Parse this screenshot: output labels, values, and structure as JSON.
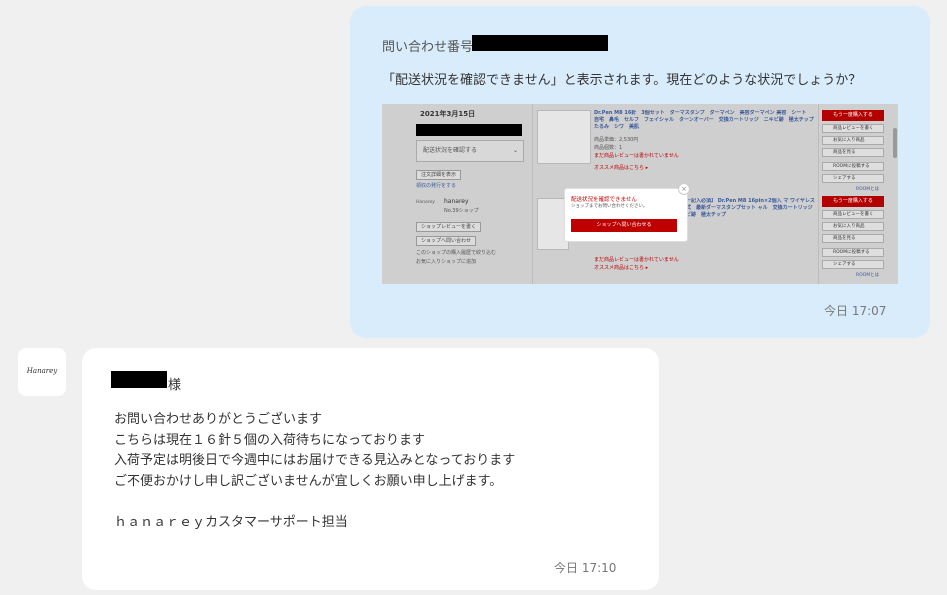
{
  "user_message": {
    "inquiry_label": "問い合わせ番号:",
    "text": "「配送状況を確認できません」と表示されます。現在どのような状況でしょうか？",
    "timestamp": "今日 17:07",
    "attached_screenshot": {
      "order_date": "2021年3月15日",
      "delivery_select": "配送状況を確認する",
      "order_detail_button": "注文詳細を表示",
      "receipt_link": "領収の発行をする",
      "shop_name": "hanarey",
      "shop_rating": "No.39ショップ",
      "shop_review_button": "ショップレビューを書く",
      "shop_contact_button": "ショップへ問い合わせ",
      "shop_note1": "このショップの購入履歴で絞り込む",
      "shop_note2": "お気に入りショップに追加",
      "product1_title": "Dr.Pen M8 16針　3個セット　ダーマスタンプ　ダーマペン　美容ダーマペン 美容　シート　自宅　鼻毛　セルフ　フェイシャル　ターンオーバー　交換カートリッジ　ニキビ跡　極太チップ　たるみ　シワ　美肌",
      "product1_price": "商品単価：2,530円",
      "product1_qty": "商品個数：1",
      "product1_review": "まだ商品レビューは書かれていません",
      "recommend": "オススメ商品はこちら ▸",
      "product2_title": "ビュー記入必須】 Dr.Pen M8 16pin×2個入 マ ワイヤレス　充電式　最新ダーマスタンプセット ャル　交換カートリッジ　ニキビ跡　極太チップ",
      "buy_again": "もう一度購入する",
      "write_review": "商品レビューを書く",
      "favorite": "お気に入り商品",
      "view_product": "商品を見る",
      "room_post": "ROOMに投稿する",
      "share": "シェアする",
      "room_link": "ROOMとは",
      "popup_title": "配送状況を確認できません",
      "popup_sub": "ショップまでお問い合わせください。",
      "popup_button": "ショップへ問い合わせる"
    }
  },
  "shop_message": {
    "shop_logo_text": "Hanarey",
    "honorific": "様",
    "lines": [
      "お問い合わせありがとうございます",
      "こちらは現在１６針５個の入荷待ちになっております",
      "入荷予定は明後日で今週中にはお届けできる見込みとなっております",
      "ご不便おかけし申し訳ございませんが宜しくお願い申し上げます。"
    ],
    "signature": "ｈａｎａｒｅｙカスタマーサポート担当",
    "timestamp": "今日 17:10"
  },
  "colors": {
    "user_bubble": "#d9ecfb",
    "shop_bubble": "#ffffff",
    "background": "#f0f0f0",
    "rakuten_red": "#bf0000"
  }
}
